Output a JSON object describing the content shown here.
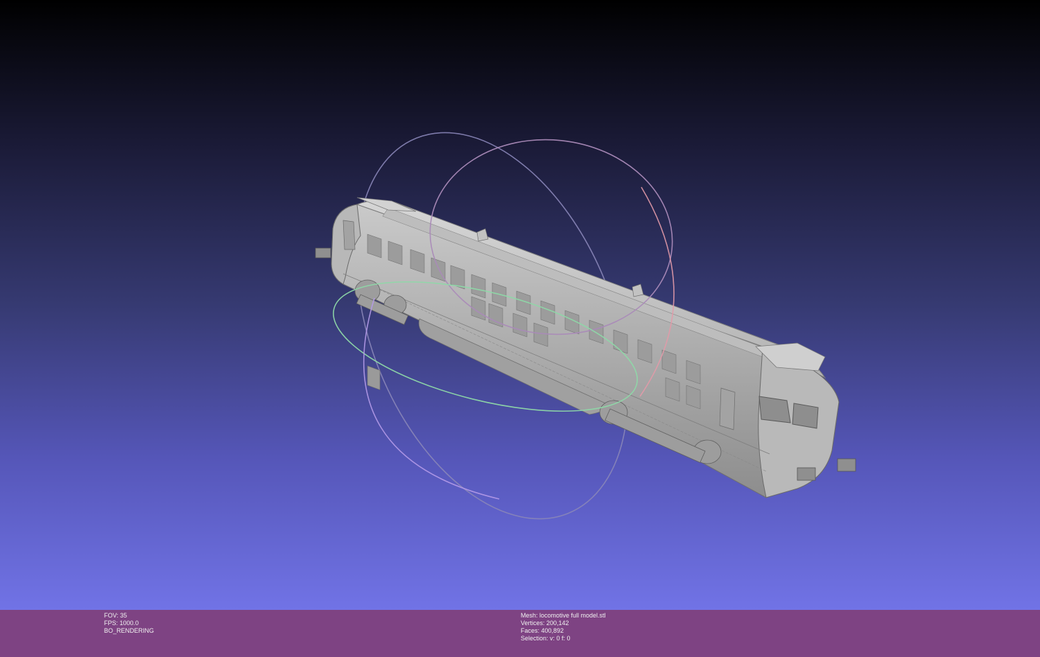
{
  "viewer": {
    "background_top": "#000000",
    "background_bottom": "#7173e6",
    "statusbar_color": "#7e4383",
    "trackball_colors": [
      "#ff7f7f",
      "#7fff7f",
      "#7f7fff"
    ]
  },
  "render_info": {
    "fov": "FOV: 35",
    "fps": "FPS:  1000.0",
    "mode": "BO_RENDERING"
  },
  "mesh_info": {
    "mesh": "Mesh: locomotive full model.stl",
    "vertices": "Vertices: 200,142",
    "faces": "Faces: 400,892",
    "selection": "Selection: v: 0 f: 0"
  }
}
